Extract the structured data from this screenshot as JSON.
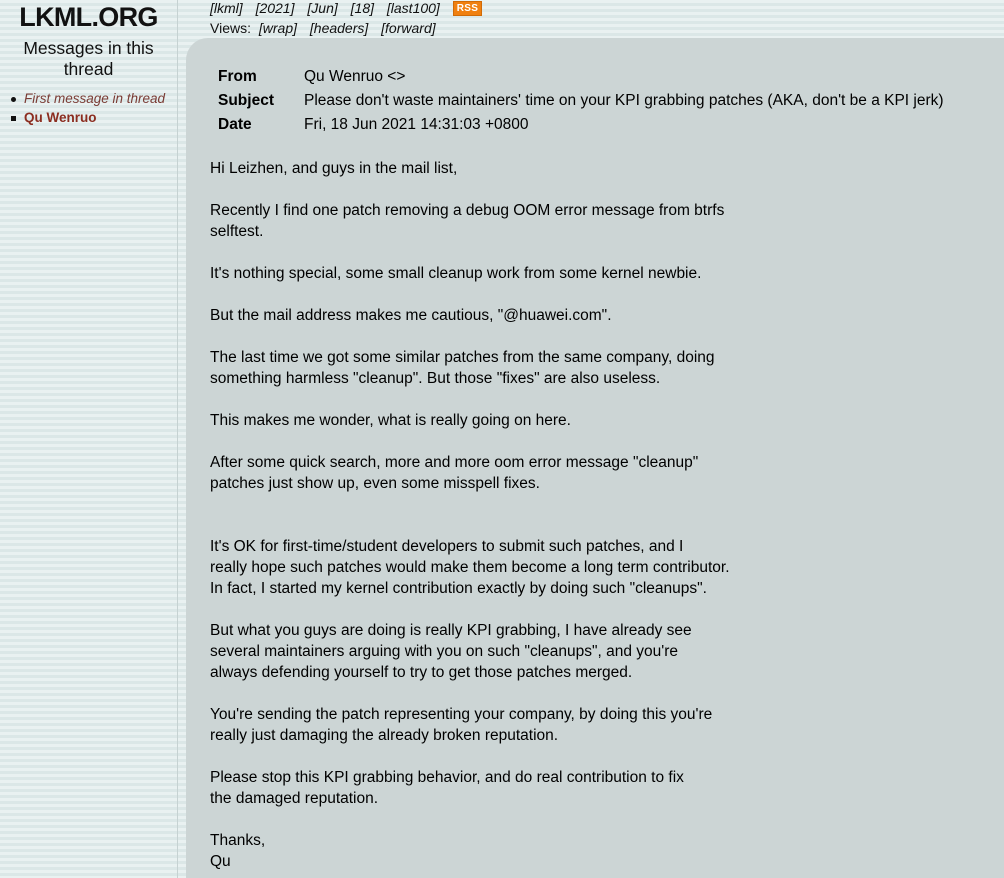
{
  "sidebar": {
    "logo": "LKML.ORG",
    "thread_title": "Messages in this thread",
    "items": [
      {
        "label": "First message in thread",
        "bullet": "disc-bullet-icon"
      },
      {
        "label": "Qu Wenruo",
        "bullet": "square-bullet-icon"
      }
    ]
  },
  "topnav": {
    "crumbs": [
      "[lkml]",
      "[2021]",
      "[Jun]",
      "[18]",
      "[last100]"
    ],
    "rss_label": "RSS",
    "views_label": "Views:",
    "view_links": [
      "[wrap]",
      "[headers]",
      "[forward]"
    ]
  },
  "message": {
    "headers": [
      {
        "label": "From",
        "value": "Qu Wenruo <>"
      },
      {
        "label": "Subject",
        "value": "Please don't waste maintainers' time on your KPI grabbing patches (AKA, don't be a KPI jerk)"
      },
      {
        "label": "Date",
        "value": "Fri, 18 Jun 2021 14:31:03 +0800"
      }
    ],
    "body": [
      "Hi Leizhen, and guys in the mail list,",
      "Recently I find one patch removing a debug OOM error message from btrfs\nselftest.",
      "It's nothing special, some small cleanup work from some kernel newbie.",
      "But the mail address makes me cautious, \"@huawei.com\".",
      "The last time we got some similar patches from the same company, doing\nsomething harmless \"cleanup\". But those \"fixes\" are also useless.",
      "This makes me wonder, what is really going on here.",
      "After some quick search, more and more oom error message \"cleanup\"\npatches just show up, even some misspell fixes.",
      "It's OK for first-time/student developers to submit such patches, and I\nreally hope such patches would make them become a long term contributor.\nIn fact, I started my kernel contribution exactly by doing such \"cleanups\".",
      "But what you guys are doing is really KPI grabbing, I have already see\nseveral maintainers arguing with you on such \"cleanups\", and you're\nalways defending yourself to try to get those patches merged.",
      "You're sending the patch representing your company, by doing this you're\nreally just damaging the already broken reputation.",
      "Please stop this KPI grabbing behavior, and do real contribution to fix\nthe damaged reputation.",
      "Thanks,\nQu"
    ]
  },
  "colors": {
    "page_bg": "#e2ecec",
    "panel_bg": "#ccd5d5",
    "rss_orange": "#f08010",
    "author_red": "#8b2d20",
    "first_msg_brown": "#7a3b34"
  }
}
